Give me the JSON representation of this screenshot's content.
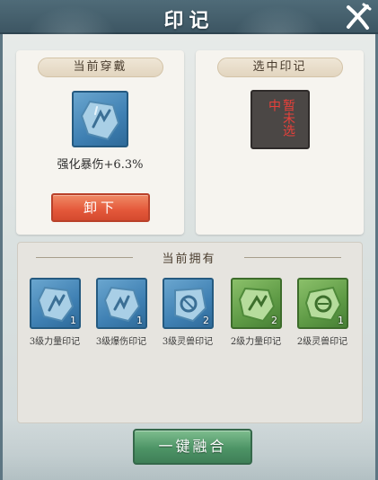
{
  "window": {
    "title": "印记"
  },
  "equipped": {
    "header": "当前穿戴",
    "item_stat": "强化暴伤+6.3%",
    "unequip_label": "卸下"
  },
  "selected": {
    "header": "选中印记",
    "placeholder_text": "暂未选中"
  },
  "owned": {
    "header": "当前拥有",
    "items": [
      {
        "name": "3级力量印记",
        "count": "1",
        "color": "blue",
        "icon": "shield-rune-icon"
      },
      {
        "name": "3级爆伤印记",
        "count": "1",
        "color": "blue",
        "icon": "shield-rune-icon"
      },
      {
        "name": "3级灵兽印记",
        "count": "2",
        "color": "blue",
        "icon": "beast-rune-icon"
      },
      {
        "name": "2级力量印记",
        "count": "2",
        "color": "green",
        "icon": "shield-rune-icon"
      },
      {
        "name": "2级灵兽印记",
        "count": "1",
        "color": "green",
        "icon": "beast-rune-icon"
      }
    ]
  },
  "actions": {
    "fuse_all_label": "一键融合"
  },
  "colors": {
    "title_bar": "#4f6b78",
    "unequip_button": "#e4583a",
    "fuse_button": "#4d9466",
    "empty_slot_text": "#e8403a"
  }
}
